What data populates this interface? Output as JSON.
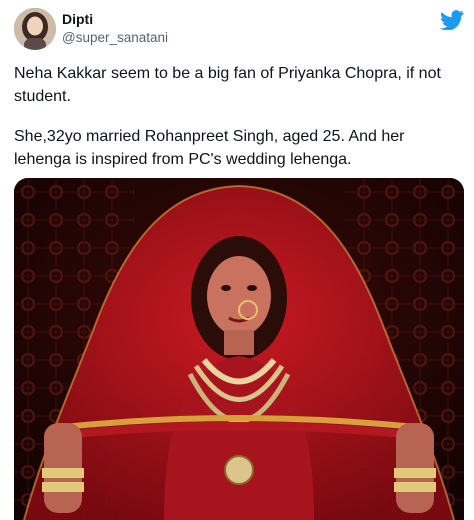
{
  "user": {
    "display_name": "Dipti",
    "handle": "@super_sanatani",
    "avatar_icon": "profile-avatar"
  },
  "tweet": {
    "paragraph_1": "Neha Kakkar seem to be a big fan of Priyanka Chopra, if not student.",
    "paragraph_2": "She,32yo married Rohanpreet Singh, aged 25. And her lehenga is inspired from PC's wedding lehenga."
  },
  "brand": {
    "icon": "twitter-bird-icon",
    "color": "#1d9bf0"
  },
  "media": {
    "type": "photo",
    "dominant_color": "#b3121b"
  }
}
